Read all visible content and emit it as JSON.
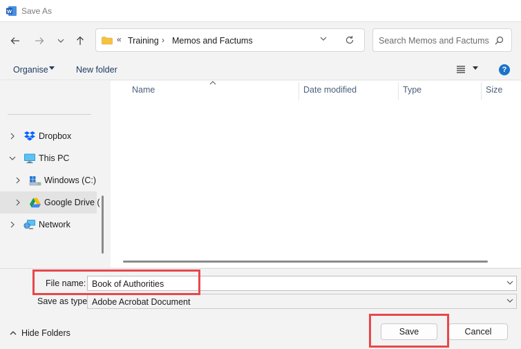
{
  "window": {
    "title": "Save As",
    "app_icon": "word-icon"
  },
  "nav": {
    "back_icon": "arrow-left-icon",
    "forward_icon": "arrow-right-icon",
    "recent_icon": "chevron-down-icon",
    "up_icon": "arrow-up-icon"
  },
  "address": {
    "overflow": "«",
    "crumbs": [
      "Training",
      "Memos and Factums"
    ],
    "separator": "›"
  },
  "search": {
    "placeholder": "Search Memos and Factums"
  },
  "toolbar": {
    "organise_label": "Organise",
    "new_folder_label": "New folder",
    "help_label": "?"
  },
  "sidebar": {
    "items": [
      {
        "label": "Dropbox",
        "icon": "dropbox-icon"
      },
      {
        "label": "This PC",
        "icon": "computer-icon"
      },
      {
        "label": "Windows (C:)",
        "icon": "drive-icon"
      },
      {
        "label": "Google Drive (",
        "icon": "google-drive-icon"
      },
      {
        "label": "Network",
        "icon": "network-icon"
      }
    ]
  },
  "filelist": {
    "columns": [
      "Name",
      "Date modified",
      "Type",
      "Size"
    ]
  },
  "fields": {
    "file_name_label": "File name:",
    "file_name_value": "Book of Authorities",
    "save_type_label": "Save as type:",
    "save_type_value": "Adobe Acrobat Document"
  },
  "footer": {
    "hide_folders_label": "Hide Folders",
    "save_label": "Save",
    "cancel_label": "Cancel"
  },
  "colors": {
    "annotation": "#e8474b",
    "accent": "#1a73c9"
  }
}
